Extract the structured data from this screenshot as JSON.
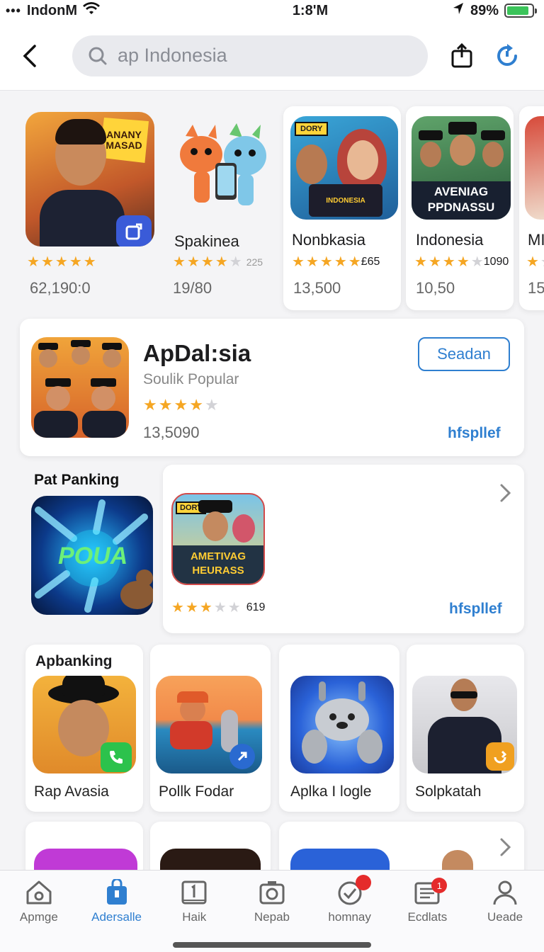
{
  "status": {
    "dots": "•••",
    "carrier": "IndonM",
    "time": "1:8'M",
    "battery": "89%",
    "battery_level": 0.89
  },
  "header": {
    "search_text": "ap Indonesia"
  },
  "top_apps": [
    {
      "name": "",
      "rating_count": "",
      "downloads": "62,190:0",
      "stars": 5
    },
    {
      "name": "Spakinea",
      "rating_count": "225",
      "downloads": "19/80",
      "stars": 4
    },
    {
      "name": "Nonbkasia",
      "rating_count": "£65",
      "downloads": "13,500",
      "stars": 4.5
    },
    {
      "name": "Indonesia",
      "rating_count": "1090",
      "downloads": "10,50",
      "stars": 4
    },
    {
      "name": "MI",
      "rating_count": "",
      "downloads": "15",
      "stars": 1
    }
  ],
  "top_app_art": [
    {
      "text": "ANANY MASAD"
    },
    {
      "text": ""
    },
    {
      "text": "DORY",
      "sub": "INDONESIA"
    },
    {
      "text": "AVENIAG PPDNASSU"
    }
  ],
  "featured": {
    "title": "ApDal:sia",
    "subtitle": "Soulik Popular",
    "downloads": "13,5090",
    "stars": 4,
    "get_label": "Seadan",
    "developer": "hfspllef"
  },
  "ranking": {
    "title": "Pat Panking",
    "art_text": "POUA",
    "card_art_text": "AMETIVAG HEURASS",
    "card_art_tag": "DORY",
    "rating_count": "619",
    "stars": 3,
    "developer": "hfspllef"
  },
  "banking": {
    "title": "Apbanking",
    "tiles": [
      {
        "name": "Rap Avasia"
      },
      {
        "name": "Pollk Fodar"
      },
      {
        "name": "Aplka I logle"
      },
      {
        "name": "Solpkatah"
      }
    ]
  },
  "tabs": [
    {
      "label": "Apmge",
      "icon": "home-icon",
      "active": false
    },
    {
      "label": "Adersalle",
      "icon": "store-icon",
      "active": true
    },
    {
      "label": "Haik",
      "icon": "calendar-icon",
      "active": false
    },
    {
      "label": "Nepab",
      "icon": "camera-icon",
      "active": false
    },
    {
      "label": "homnay",
      "icon": "check-icon",
      "active": false,
      "dot": true
    },
    {
      "label": "Ecdlats",
      "icon": "news-icon",
      "active": false,
      "badge": "1"
    },
    {
      "label": "Ueade",
      "icon": "person-icon",
      "active": false
    }
  ],
  "colors": {
    "accent": "#2f7fd0",
    "star": "#f5a623",
    "badge": "#e52b2b"
  }
}
